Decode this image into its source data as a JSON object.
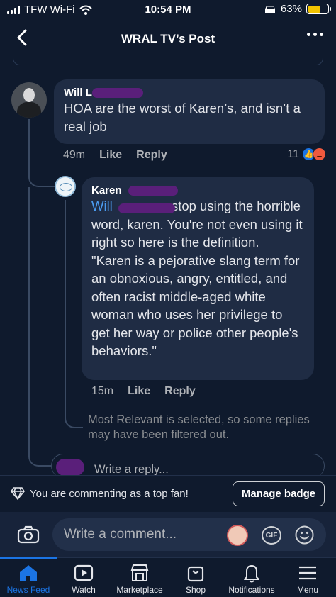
{
  "status_bar": {
    "carrier": "TFW Wi-Fi",
    "time": "10:54 PM",
    "battery": "63%",
    "battery_level": 0.63,
    "battery_color": "#f2c300"
  },
  "header": {
    "back_icon": "chevron-left-icon",
    "title": "WRAL TV’s Post",
    "more_icon": "more-dots-icon"
  },
  "comments": [
    {
      "author": "Will L",
      "text": "HOA are the worst of Karen’s, and isn’t a real job",
      "time": "49m",
      "like_label": "Like",
      "reply_label": "Reply",
      "reaction_count": "11",
      "reactions": [
        "like-icon",
        "angry-icon"
      ]
    }
  ],
  "reply": {
    "author": "Karen",
    "mention": "Will",
    "text_after_mention": "stop using the horrible word, karen. You're not even using it right so here is the definition.",
    "quote": "\"Karen is a pejorative slang term for an obnoxious, angry, entitled, and often racist middle-aged white woman who uses her privilege to get her way or police other people's behaviors.\"",
    "time": "15m",
    "like_label": "Like",
    "reply_label": "Reply"
  },
  "filter_notice": "Most Relevant is selected, so some replies may have been filtered out.",
  "reply_input": {
    "placeholder": "Write a reply..."
  },
  "fan_bar": {
    "icon": "diamond-icon",
    "message": "You are commenting as a top fan!",
    "button": "Manage badge"
  },
  "composer": {
    "camera_icon": "camera-icon",
    "placeholder": "Write a comment...",
    "gif_label": "GIF",
    "emoji_icon": "smiley-icon"
  },
  "tabs": [
    {
      "label": "News Feed",
      "icon": "home-icon",
      "active": true
    },
    {
      "label": "Watch",
      "icon": "play-icon",
      "active": false
    },
    {
      "label": "Marketplace",
      "icon": "store-icon",
      "active": false
    },
    {
      "label": "Shop",
      "icon": "bag-icon",
      "active": false
    },
    {
      "label": "Notifications",
      "icon": "bell-icon",
      "active": false
    },
    {
      "label": "Menu",
      "icon": "hamburger-icon",
      "active": false
    }
  ],
  "colors": {
    "background": "#0f1a2d",
    "bubble": "#1f2c44",
    "accent": "#1b74e4",
    "mention": "#4b9bf0"
  }
}
